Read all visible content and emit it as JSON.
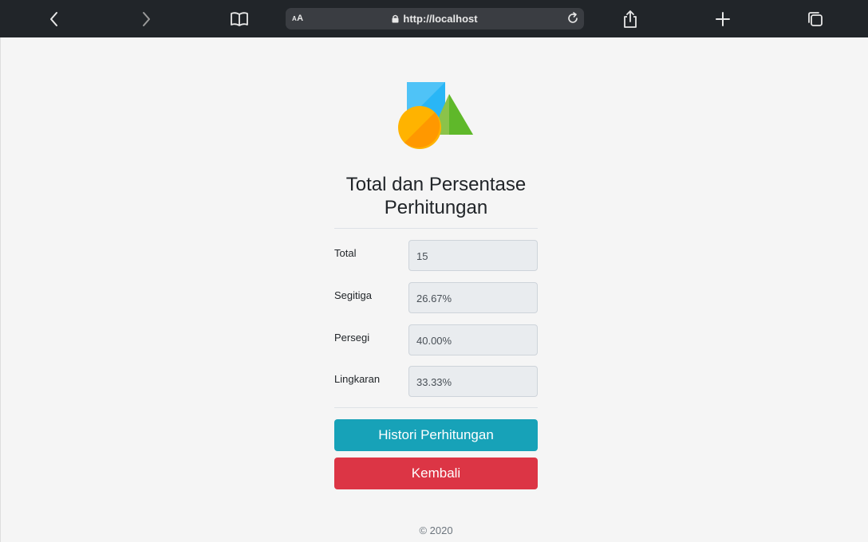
{
  "browser": {
    "aa_big": "A",
    "aa_small": "A",
    "url": "http://localhost",
    "icons": [
      "back-icon",
      "forward-icon",
      "bookmarks-icon",
      "lock-icon",
      "reload-icon",
      "share-icon",
      "new-tab-icon",
      "tabs-icon"
    ]
  },
  "page": {
    "title": "Total dan Persentase Perhitungan",
    "logo_icon": "shapes-logo-icon",
    "colors": {
      "square": "#4fc3f7",
      "triangle": "#6abf2e",
      "circle": "#ffab00",
      "info_button": "#17a2b8",
      "danger_button": "#dc3545"
    },
    "rows": [
      {
        "label": "Total",
        "value": "15"
      },
      {
        "label": "Segitiga",
        "value": "26.67%"
      },
      {
        "label": "Persegi",
        "value": "40.00%"
      },
      {
        "label": "Lingkaran",
        "value": "33.33%"
      }
    ],
    "buttons": {
      "history": "Histori Perhitungan",
      "back": "Kembali"
    },
    "footer": "© 2020"
  }
}
